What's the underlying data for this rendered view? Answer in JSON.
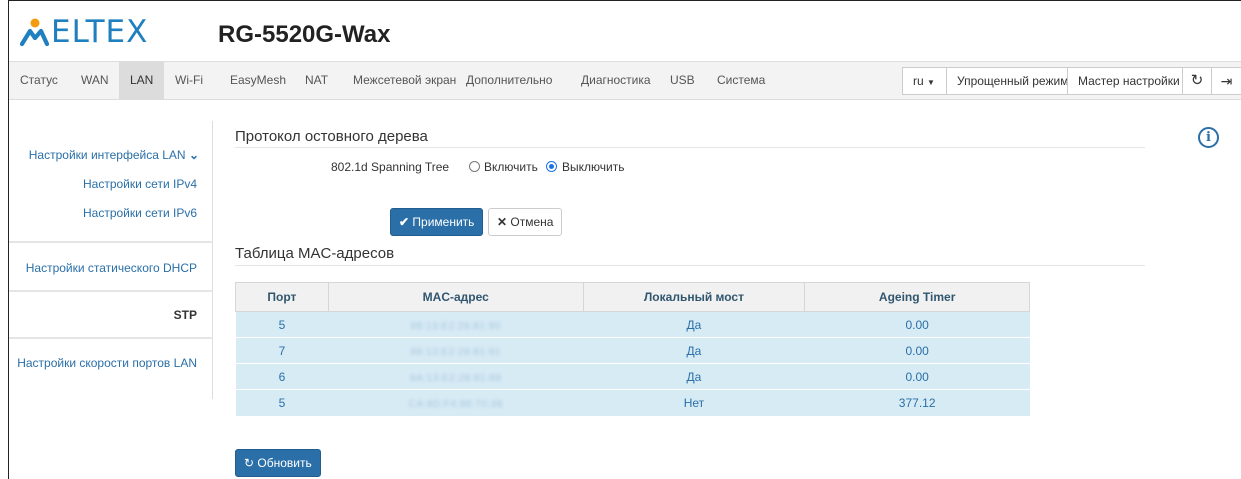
{
  "header": {
    "logo_text": "ELTEX",
    "device_name": "RG-5520G-Wax",
    "brand_color": "#1f7fbf"
  },
  "nav": {
    "items": [
      "Статус",
      "WAN",
      "LAN",
      "Wi-Fi",
      "EasyMesh",
      "NAT",
      "Межсетевой экран",
      "Дополнительно",
      "Диагностика",
      "USB",
      "Система"
    ],
    "active": "LAN",
    "language": "ru",
    "simple_mode": "Упрощенный режим",
    "wizard": "Мастер настройки",
    "refresh_icon": "refresh-icon",
    "logout_icon": "logout-icon"
  },
  "sidebar": {
    "lan_group": "Настройки интерфейса LAN",
    "ipv4": "Настройки сети IPv4",
    "ipv6": "Настройки сети IPv6",
    "dhcp": "Настройки статического DHCP",
    "stp": "STP",
    "port_speed": "Настройки скорости портов LAN",
    "active": "STP"
  },
  "stp": {
    "title": "Протокол остовного дерева",
    "field_label": "802.1d Spanning Tree",
    "enable_label": "Включить",
    "disable_label": "Выключить",
    "selected": "Выключить",
    "apply": "Применить",
    "cancel": "Отмена"
  },
  "mac_table": {
    "title": "Таблица MAC-адресов",
    "headers": [
      "Порт",
      "MAC-адрес",
      "Локальный мост",
      "Ageing Timer"
    ],
    "rows": [
      [
        "5",
        "88:13:E2:28:81:90",
        "Да",
        "0.00"
      ],
      [
        "7",
        "88:13:E2:28:81:91",
        "Да",
        "0.00"
      ],
      [
        "6",
        "8A:13:E2:28:81:88",
        "Да",
        "0.00"
      ],
      [
        "5",
        "CA:8D:F4:88:70:38",
        "Нет",
        "377.12"
      ]
    ],
    "refresh": "Обновить"
  }
}
